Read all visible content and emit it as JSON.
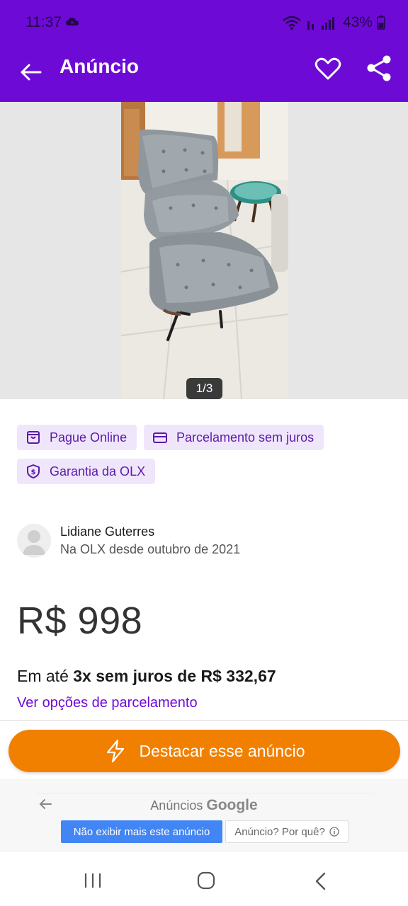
{
  "status_bar": {
    "time": "11:37",
    "battery": "43%",
    "icons": [
      "cloud-icon",
      "wifi-icon",
      "signal-icon",
      "battery-icon"
    ]
  },
  "app_bar": {
    "title": "Anúncio",
    "icons": [
      "back-arrow-icon",
      "heart-icon",
      "share-icon"
    ]
  },
  "gallery": {
    "counter": "1/3"
  },
  "badges": [
    {
      "label": "Pague Online",
      "icon": "bag-icon"
    },
    {
      "label": "Parcelamento sem juros",
      "icon": "card-icon"
    },
    {
      "label": "Garantia da OLX",
      "icon": "shield-icon"
    }
  ],
  "seller": {
    "name": "Lidiane Guterres",
    "since": "Na OLX desde outubro de 2021"
  },
  "price": {
    "value": "R$ 998",
    "installments_prefix": "Em até ",
    "installments_bold": "3x sem juros de R$ 332,67",
    "installments_link": "Ver opções de parcelamento"
  },
  "cta": {
    "label": "Destacar esse anúncio",
    "icon": "lightning-icon"
  },
  "google_ads": {
    "title_prefix": "Anúncios ",
    "title_brand": "Google",
    "hide_button": "Não exibir mais este anúncio",
    "why_button": "Anúncio? Por quê?"
  },
  "colors": {
    "brand_purple": "#6e0ad6",
    "cta_orange": "#f28000",
    "badge_bg": "#f0e6fc",
    "google_blue": "#4285f4"
  }
}
